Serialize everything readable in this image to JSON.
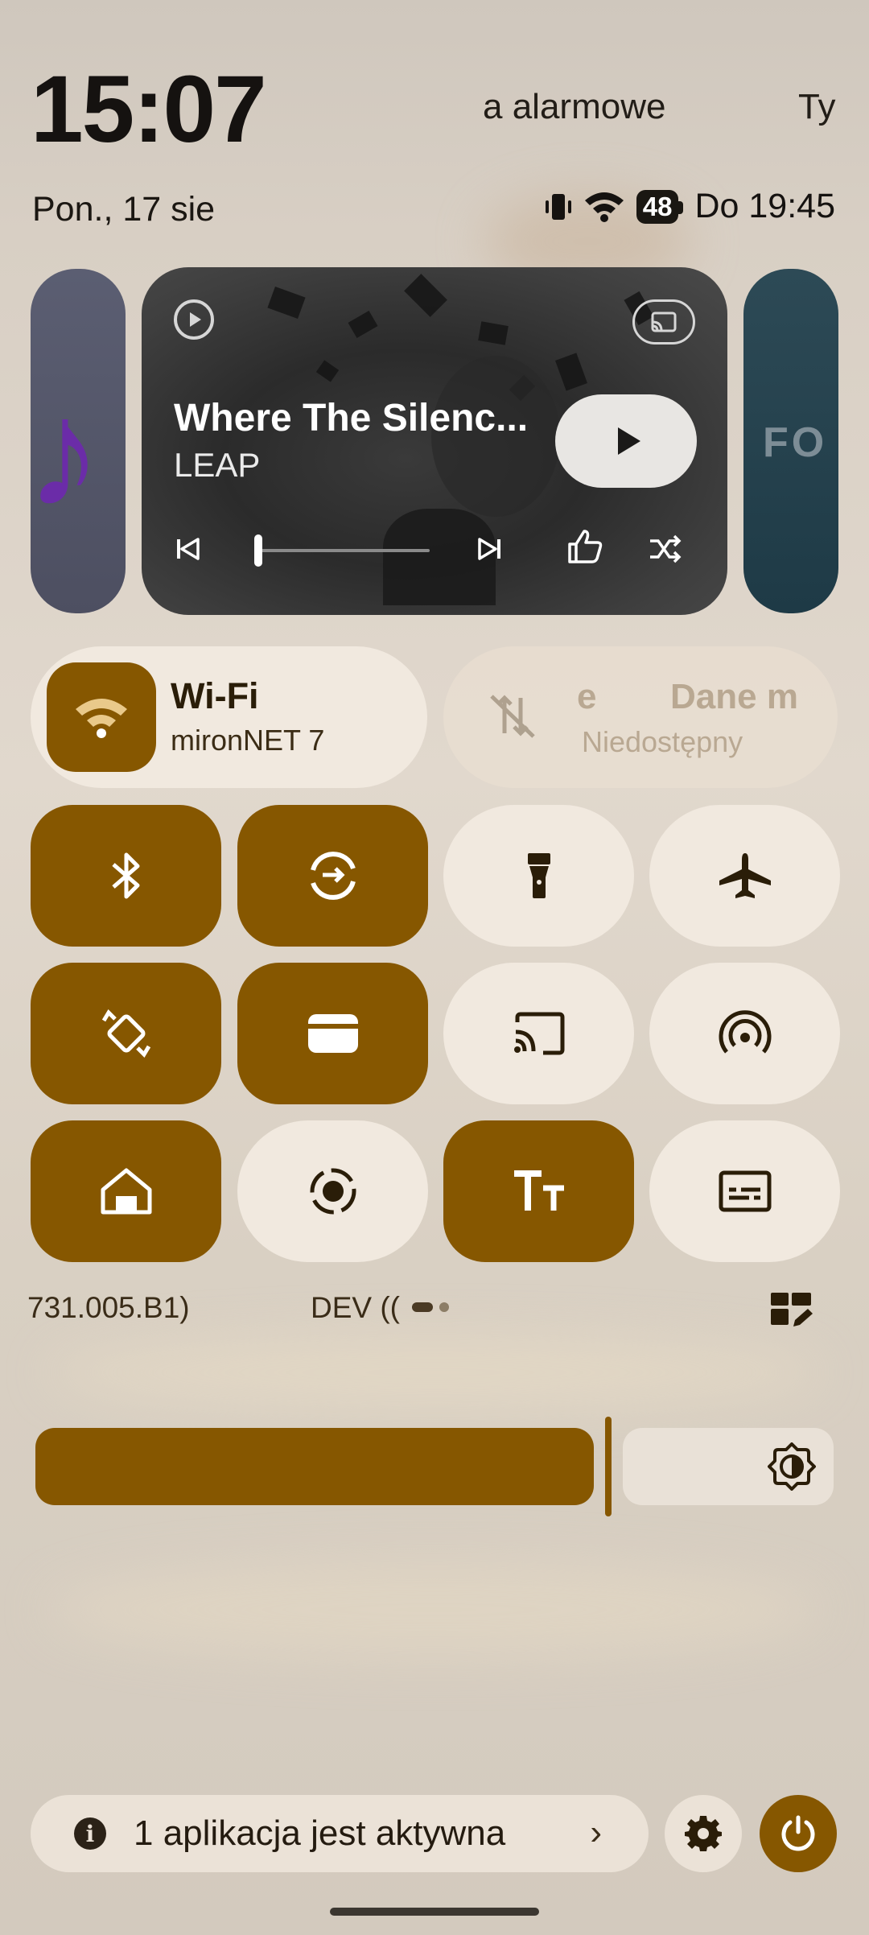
{
  "header": {
    "time": "15:07",
    "alarm_text": "a alarmowe",
    "ty_text": "Ty",
    "date": "Pon., 17 sie",
    "battery_level": "48",
    "battery_until": "Do 19:45"
  },
  "media": {
    "title": "Where The Silenc...",
    "artist": "LEAP",
    "progress": 0.02,
    "side_right_text": "FO"
  },
  "tiles": {
    "wifi": {
      "label": "Wi-Fi",
      "network": "mironNET 7"
    },
    "mobile_data": {
      "label": "Dane m",
      "prefix": "e",
      "status": "Niedostępny"
    },
    "grid": [
      {
        "name": "bluetooth",
        "on": true
      },
      {
        "name": "data-saver",
        "on": true
      },
      {
        "name": "flashlight",
        "on": false
      },
      {
        "name": "airplane-mode",
        "on": false
      },
      {
        "name": "auto-rotate",
        "on": true
      },
      {
        "name": "wallet",
        "on": true
      },
      {
        "name": "screen-cast",
        "on": false
      },
      {
        "name": "hotspot",
        "on": false
      },
      {
        "name": "home",
        "on": true
      },
      {
        "name": "screen-record",
        "on": false
      },
      {
        "name": "font-size",
        "on": true
      },
      {
        "name": "live-caption",
        "on": false
      }
    ]
  },
  "build": {
    "version": "731.005.B1)",
    "channel": "DEV (("
  },
  "brightness": {
    "level_percent": 70
  },
  "footer": {
    "active_apps": "1 aplikacja jest aktywna"
  },
  "colors": {
    "accent": "#865700",
    "tile_off": "#f1e9df",
    "background": "#d8cfc4"
  }
}
